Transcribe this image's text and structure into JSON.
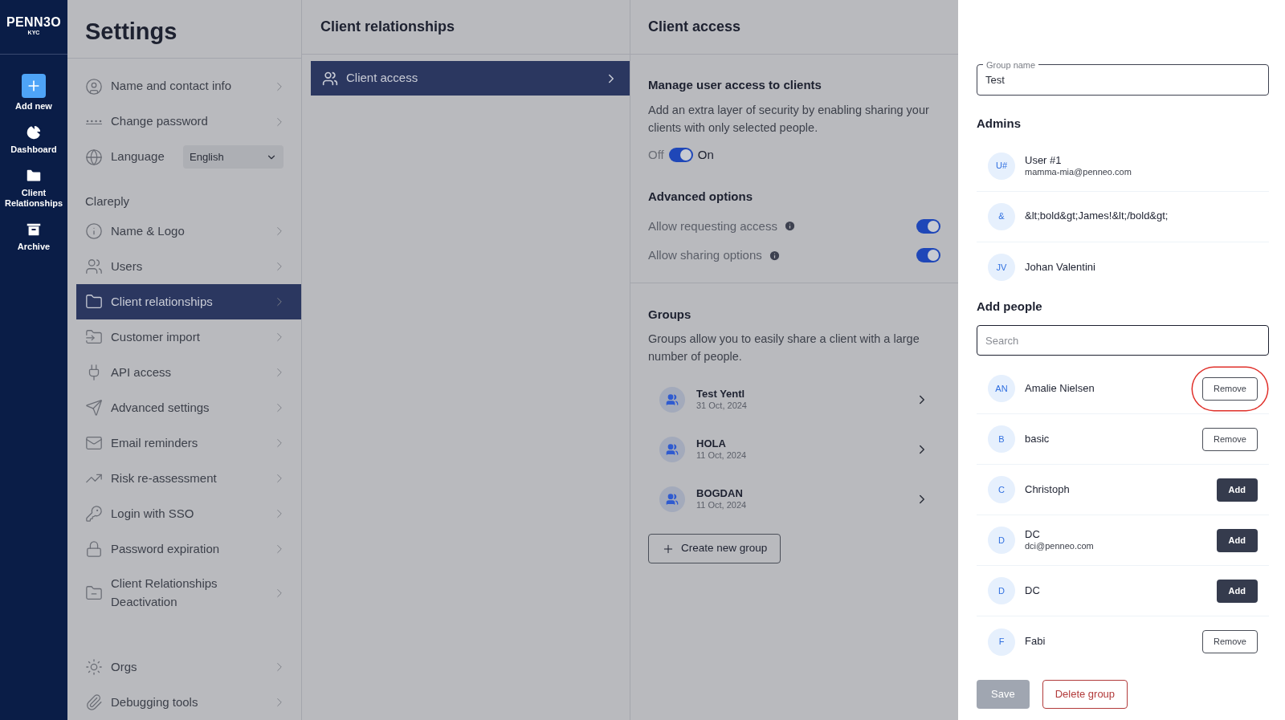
{
  "nav": {
    "logo": "PENN3O",
    "logo_sub": "KYC",
    "items": [
      {
        "label": "Add new",
        "kind": "add"
      },
      {
        "label": "Dashboard",
        "kind": "dashboard"
      },
      {
        "label": "Client Relationships",
        "kind": "clients"
      },
      {
        "label": "Archive",
        "kind": "archive"
      }
    ]
  },
  "settings": {
    "title": "Settings",
    "groups": [
      {
        "items": [
          {
            "label": "Name and contact info",
            "kind": "link",
            "selected": false
          },
          {
            "label": "Change password",
            "kind": "link",
            "selected": false
          },
          {
            "label": "Language",
            "kind": "select",
            "value": "English"
          }
        ]
      },
      {
        "heading": "Clareply",
        "items": [
          {
            "label": "Name & Logo",
            "kind": "link",
            "selected": false
          },
          {
            "label": "Users",
            "kind": "link",
            "selected": false
          },
          {
            "label": "Client relationships",
            "kind": "link",
            "selected": true
          },
          {
            "label": "Customer import",
            "kind": "link",
            "selected": false
          },
          {
            "label": "API access",
            "kind": "link",
            "selected": false
          },
          {
            "label": "Advanced settings",
            "kind": "link",
            "selected": false
          },
          {
            "label": "Email reminders",
            "kind": "link",
            "selected": false
          },
          {
            "label": "Risk re-assessment",
            "kind": "link",
            "selected": false
          },
          {
            "label": "Login with SSO",
            "kind": "link",
            "selected": false
          },
          {
            "label": "Password expiration",
            "kind": "link",
            "selected": false
          },
          {
            "label": "Client Relationships Deactivation",
            "kind": "link",
            "selected": false
          }
        ]
      },
      {
        "items": [
          {
            "label": "Orgs",
            "kind": "link",
            "selected": false
          },
          {
            "label": "Debugging tools",
            "kind": "link",
            "selected": false
          }
        ]
      }
    ]
  },
  "relationships": {
    "title": "Client relationships",
    "items": [
      {
        "label": "Client access",
        "selected": true
      }
    ]
  },
  "access": {
    "title": "Client access",
    "manage_title": "Manage user access to clients",
    "manage_text": "Add an extra layer of security by enabling sharing your clients with only selected people.",
    "off_label": "Off",
    "on_label": "On",
    "enabled": true,
    "advanced_title": "Advanced options",
    "options": [
      {
        "label": "Allow requesting access",
        "on": true
      },
      {
        "label": "Allow sharing options",
        "on": true
      }
    ],
    "groups_title": "Groups",
    "groups_text": "Groups allow you to easily share a client with a large number of people.",
    "groups": [
      {
        "name": "Test Yentl",
        "date": "31 Oct, 2024"
      },
      {
        "name": "HOLA",
        "date": "11 Oct, 2024"
      },
      {
        "name": "BOGDAN",
        "date": "11 Oct, 2024"
      }
    ],
    "create_button": "Create new group"
  },
  "drawer": {
    "group_name_label": "Group name",
    "group_name": "Test",
    "admins_title": "Admins",
    "admins": [
      {
        "initials": "U#",
        "name": "User #1",
        "email": "mamma-mia@penneo.com"
      },
      {
        "initials": "&",
        "name": "&lt;bold&gt;James!&lt;/bold&gt;"
      },
      {
        "initials": "JV",
        "name": "Johan Valentini"
      }
    ],
    "add_title": "Add people",
    "search_placeholder": "Search",
    "people": [
      {
        "initials": "AN",
        "name": "Amalie Nielsen",
        "kind": "remove",
        "label": "Remove",
        "highlighted": true
      },
      {
        "initials": "B",
        "name": "basic",
        "kind": "remove",
        "label": "Remove",
        "highlighted": false
      },
      {
        "initials": "C",
        "name": "Christoph",
        "kind": "add",
        "label": "Add",
        "highlighted": false
      },
      {
        "initials": "D",
        "name": "DC",
        "email": "dci@penneo.com",
        "kind": "add",
        "label": "Add",
        "highlighted": false
      },
      {
        "initials": "D",
        "name": "DC",
        "kind": "add",
        "label": "Add",
        "highlighted": false
      },
      {
        "initials": "F",
        "name": "Fabi",
        "kind": "remove",
        "label": "Remove",
        "highlighted": false
      }
    ],
    "save": "Save",
    "save_disabled": true,
    "delete": "Delete group"
  }
}
